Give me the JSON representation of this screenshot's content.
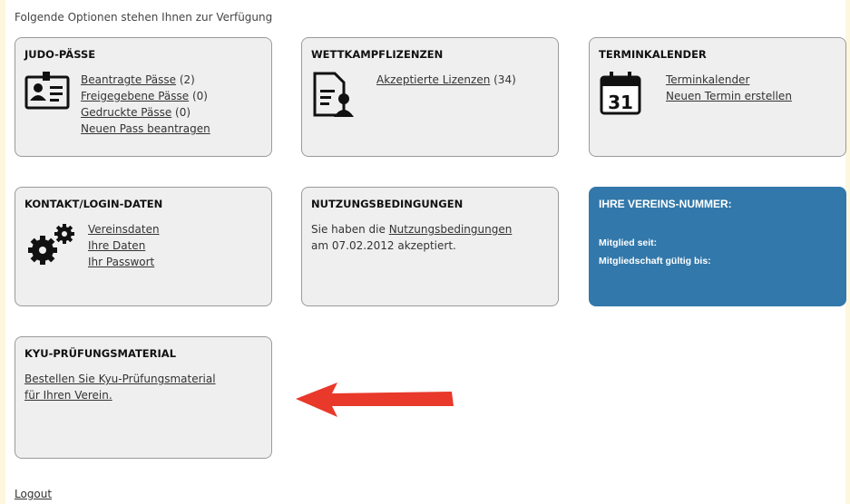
{
  "intro": "Folgende Optionen stehen Ihnen zur Verfügung",
  "cards": {
    "judo": {
      "title": "JUDO-PÄSSE",
      "links": [
        {
          "label": "Beantragte Pässe",
          "count": " (2)"
        },
        {
          "label": "Freigegebene Pässe",
          "count": " (0)"
        },
        {
          "label": "Gedruckte Pässe",
          "count": " (0)"
        },
        {
          "label": "Neuen Pass beantragen",
          "count": ""
        }
      ]
    },
    "wettkampf": {
      "title": "WETTKAMPFLIZENZEN",
      "links": [
        {
          "label": "Akzeptierte Lizenzen",
          "count": " (34)"
        }
      ]
    },
    "termin": {
      "title": "TERMINKALENDER",
      "calendar_day": "31",
      "links": [
        {
          "label": "Terminkalender"
        },
        {
          "label": "Neuen Termin erstellen"
        }
      ]
    },
    "kontakt": {
      "title": "KONTAKT/LOGIN-DATEN",
      "links": [
        {
          "label": "Vereinsdaten"
        },
        {
          "label": "Ihre Daten"
        },
        {
          "label": "Ihr Passwort"
        }
      ]
    },
    "nutzung": {
      "title": "NUTZUNGSBEDINGUNGEN",
      "text_before": "Sie haben die ",
      "link": "Nutzungsbedingungen",
      "text_after": "am 07.02.2012 akzeptiert."
    },
    "verein": {
      "title": "IHRE VEREINS-NUMMER:",
      "member_since": "Mitglied seit:",
      "valid_until": "Mitgliedschaft gültig bis:"
    },
    "kyu": {
      "title": "KYU-PRÜFUNGSMATERIAL",
      "link_line1": "Bestellen Sie Kyu-Prüfungsmaterial",
      "link_line2": "für Ihren Verein."
    }
  },
  "logout": "Logout",
  "colors": {
    "accent": "#3278aa",
    "arrow": "#e8392a",
    "card_bg": "#efefef"
  }
}
